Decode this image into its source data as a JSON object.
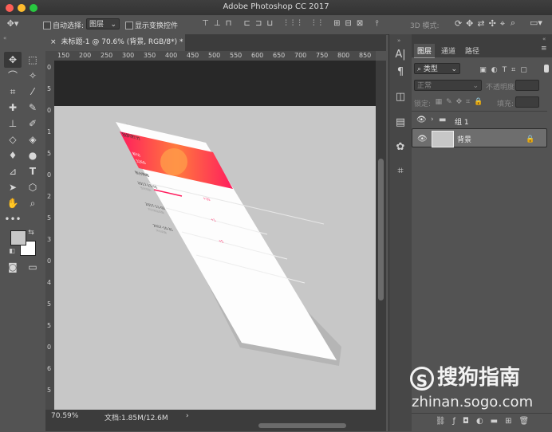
{
  "window": {
    "title": "Adobe Photoshop CC 2017"
  },
  "options_bar": {
    "auto_select_label": "自动选择:",
    "auto_select_value": "图层",
    "show_transform_label": "显示变换控件",
    "mode_3d_label": "3D 模式:"
  },
  "document": {
    "tab_title": "未标题-1 @ 70.6% (背景, RGB/8*) *",
    "zoom": "70.59%",
    "doc_info": "文档:1.85M/12.6M"
  },
  "ruler": {
    "top_ticks": [
      "150",
      "200",
      "250",
      "300",
      "350",
      "400",
      "450",
      "500",
      "550",
      "600",
      "650",
      "700",
      "750",
      "800",
      "850"
    ],
    "left_ticks": [
      "0",
      "5",
      "0",
      "1",
      "5",
      "0",
      "2",
      "5",
      "3",
      "0",
      "4",
      "5",
      "5",
      "0",
      "6",
      "5"
    ]
  },
  "layers_panel": {
    "tabs": [
      "图层",
      "通道",
      "路径"
    ],
    "filter_label": "类型",
    "blend_mode": "正常",
    "opacity_label": "不透明度:",
    "lock_label": "锁定:",
    "fill_label": "填充:",
    "layers": [
      {
        "name": "组 1",
        "type": "group"
      },
      {
        "name": "背景",
        "type": "background",
        "locked": true
      }
    ]
  },
  "canvas_mockup": {
    "header_title": "我的积分",
    "banner_line1": "积分",
    "banner_line2": "3260",
    "tab_label": "积分明细",
    "entries": [
      {
        "date": "2017-11-05",
        "desc": "签到奖励",
        "points": "+10"
      },
      {
        "date": "2017-11-02",
        "desc": "购买商品奖励",
        "points": "+1"
      },
      {
        "date": "2017-10-31",
        "desc": "评论奖励",
        "points": "+5"
      }
    ]
  },
  "watermark": {
    "brand": "搜狗指南",
    "url": "zhinan.sogo.com"
  },
  "colors": {
    "accent_pink": "#ff1d5e",
    "accent_orange": "#ff8a3d",
    "artboard": "#c7c7c7",
    "panel": "#535353"
  }
}
